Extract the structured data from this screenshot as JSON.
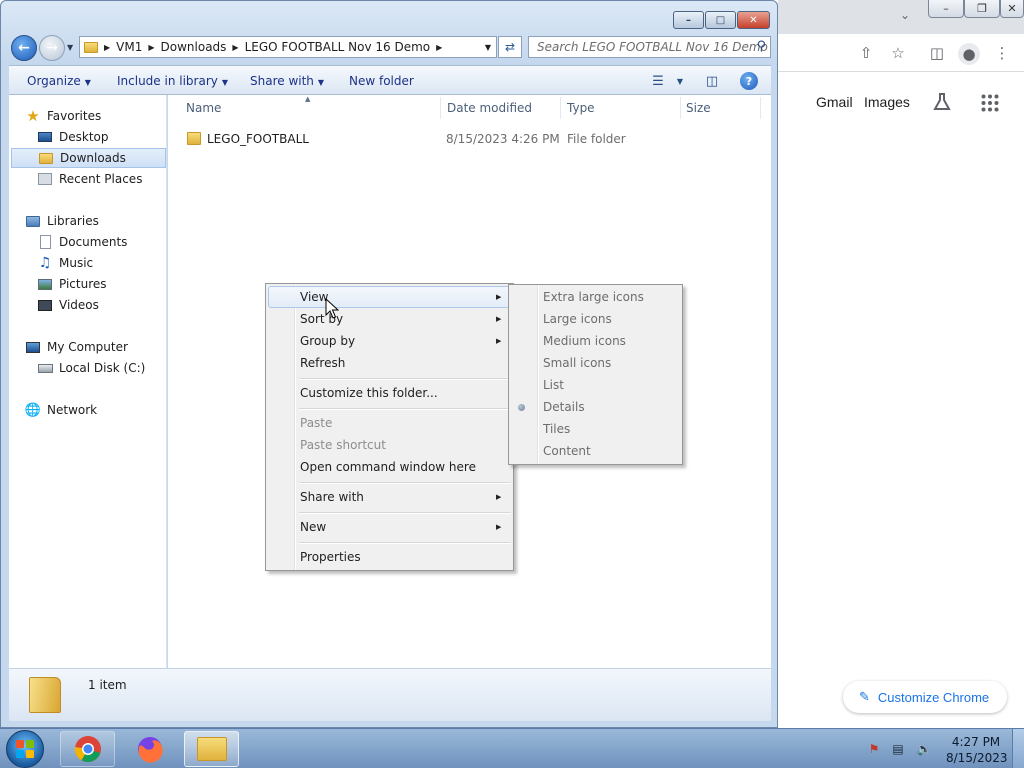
{
  "chrome": {
    "links": {
      "gmail": "Gmail",
      "images": "Images"
    },
    "customize_label": "Customize Chrome"
  },
  "explorer": {
    "address": {
      "crumbs": [
        "VM1",
        "Downloads",
        "LEGO FOOTBALL Nov 16 Demo"
      ]
    },
    "search": {
      "placeholder": "Search LEGO FOOTBALL Nov 16 Demo"
    },
    "cmdbar": {
      "organize": "Organize",
      "include_in_library": "Include in library",
      "share_with": "Share with",
      "new_folder": "New folder"
    },
    "nav": {
      "favorites": "Favorites",
      "desktop": "Desktop",
      "downloads": "Downloads",
      "recent_places": "Recent Places",
      "libraries": "Libraries",
      "documents": "Documents",
      "music": "Music",
      "pictures": "Pictures",
      "videos": "Videos",
      "my_computer": "My Computer",
      "local_disk": "Local Disk (C:)",
      "network": "Network"
    },
    "columns": {
      "name": "Name",
      "date_modified": "Date modified",
      "type": "Type",
      "size": "Size"
    },
    "files": [
      {
        "name": "LEGO_FOOTBALL",
        "date_modified": "8/15/2023 4:26 PM",
        "type": "File folder",
        "size": ""
      }
    ],
    "status": {
      "item_count": "1 item"
    }
  },
  "context_menu": {
    "view": "View",
    "sort_by": "Sort by",
    "group_by": "Group by",
    "refresh": "Refresh",
    "customize_folder": "Customize this folder...",
    "paste": "Paste",
    "paste_shortcut": "Paste shortcut",
    "open_command_window": "Open command window here",
    "share_with": "Share with",
    "new": "New",
    "properties": "Properties"
  },
  "view_submenu": {
    "items": [
      "Extra large icons",
      "Large icons",
      "Medium icons",
      "Small icons",
      "List",
      "Details",
      "Tiles",
      "Content"
    ],
    "selected": "Details"
  },
  "taskbar": {
    "time": "4:27 PM",
    "date": "8/15/2023"
  },
  "colors": {
    "selection_blue": "#cfe0f5",
    "chrome_link_blue": "#1a73e8",
    "close_red": "#c7402c"
  }
}
